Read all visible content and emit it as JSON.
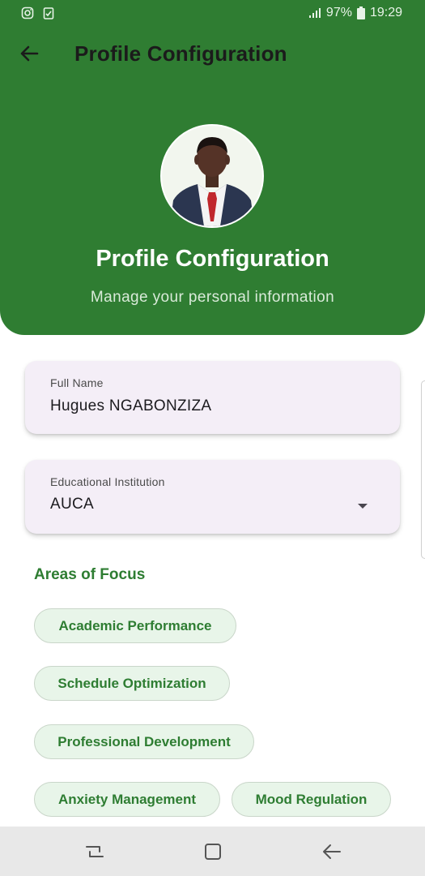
{
  "status_bar": {
    "left_icons": [
      "instagram-icon",
      "clipboard-check-icon"
    ],
    "battery": "97%",
    "time": "19:29"
  },
  "app_bar": {
    "title": "Profile Configuration",
    "back_icon": "arrow-left-icon"
  },
  "hero": {
    "title": "Profile Configuration",
    "subtitle": "Manage your personal information"
  },
  "form": {
    "full_name": {
      "label": "Full Name",
      "value": "Hugues NGABONZIZA"
    },
    "institution": {
      "label": "Educational Institution",
      "value": "AUCA"
    }
  },
  "areas_of_focus": {
    "title": "Areas of Focus",
    "chips": [
      "Academic Performance",
      "Schedule Optimization",
      "Professional Development",
      "Anxiety Management",
      "Mood Regulation"
    ]
  },
  "colors": {
    "header_green": "#2f7d32",
    "chip_text": "#2e7d32",
    "chip_bg": "#e8f5e9",
    "card_bg": "#f4eef7"
  }
}
